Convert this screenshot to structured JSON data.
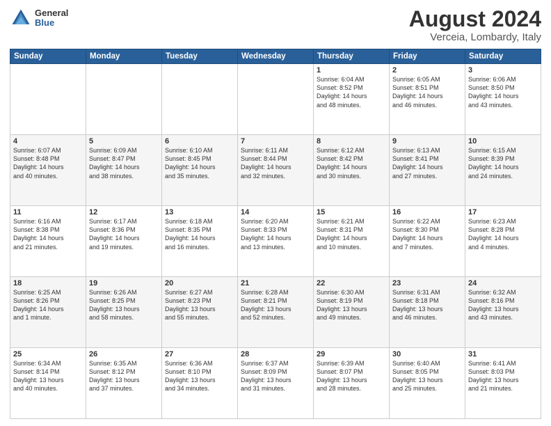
{
  "header": {
    "logo_general": "General",
    "logo_blue": "Blue",
    "title": "August 2024",
    "subtitle": "Verceia, Lombardy, Italy"
  },
  "weekdays": [
    "Sunday",
    "Monday",
    "Tuesday",
    "Wednesday",
    "Thursday",
    "Friday",
    "Saturday"
  ],
  "weeks": [
    [
      {
        "day": "",
        "info": ""
      },
      {
        "day": "",
        "info": ""
      },
      {
        "day": "",
        "info": ""
      },
      {
        "day": "",
        "info": ""
      },
      {
        "day": "1",
        "info": "Sunrise: 6:04 AM\nSunset: 8:52 PM\nDaylight: 14 hours\nand 48 minutes."
      },
      {
        "day": "2",
        "info": "Sunrise: 6:05 AM\nSunset: 8:51 PM\nDaylight: 14 hours\nand 46 minutes."
      },
      {
        "day": "3",
        "info": "Sunrise: 6:06 AM\nSunset: 8:50 PM\nDaylight: 14 hours\nand 43 minutes."
      }
    ],
    [
      {
        "day": "4",
        "info": "Sunrise: 6:07 AM\nSunset: 8:48 PM\nDaylight: 14 hours\nand 40 minutes."
      },
      {
        "day": "5",
        "info": "Sunrise: 6:09 AM\nSunset: 8:47 PM\nDaylight: 14 hours\nand 38 minutes."
      },
      {
        "day": "6",
        "info": "Sunrise: 6:10 AM\nSunset: 8:45 PM\nDaylight: 14 hours\nand 35 minutes."
      },
      {
        "day": "7",
        "info": "Sunrise: 6:11 AM\nSunset: 8:44 PM\nDaylight: 14 hours\nand 32 minutes."
      },
      {
        "day": "8",
        "info": "Sunrise: 6:12 AM\nSunset: 8:42 PM\nDaylight: 14 hours\nand 30 minutes."
      },
      {
        "day": "9",
        "info": "Sunrise: 6:13 AM\nSunset: 8:41 PM\nDaylight: 14 hours\nand 27 minutes."
      },
      {
        "day": "10",
        "info": "Sunrise: 6:15 AM\nSunset: 8:39 PM\nDaylight: 14 hours\nand 24 minutes."
      }
    ],
    [
      {
        "day": "11",
        "info": "Sunrise: 6:16 AM\nSunset: 8:38 PM\nDaylight: 14 hours\nand 21 minutes."
      },
      {
        "day": "12",
        "info": "Sunrise: 6:17 AM\nSunset: 8:36 PM\nDaylight: 14 hours\nand 19 minutes."
      },
      {
        "day": "13",
        "info": "Sunrise: 6:18 AM\nSunset: 8:35 PM\nDaylight: 14 hours\nand 16 minutes."
      },
      {
        "day": "14",
        "info": "Sunrise: 6:20 AM\nSunset: 8:33 PM\nDaylight: 14 hours\nand 13 minutes."
      },
      {
        "day": "15",
        "info": "Sunrise: 6:21 AM\nSunset: 8:31 PM\nDaylight: 14 hours\nand 10 minutes."
      },
      {
        "day": "16",
        "info": "Sunrise: 6:22 AM\nSunset: 8:30 PM\nDaylight: 14 hours\nand 7 minutes."
      },
      {
        "day": "17",
        "info": "Sunrise: 6:23 AM\nSunset: 8:28 PM\nDaylight: 14 hours\nand 4 minutes."
      }
    ],
    [
      {
        "day": "18",
        "info": "Sunrise: 6:25 AM\nSunset: 8:26 PM\nDaylight: 14 hours\nand 1 minute."
      },
      {
        "day": "19",
        "info": "Sunrise: 6:26 AM\nSunset: 8:25 PM\nDaylight: 13 hours\nand 58 minutes."
      },
      {
        "day": "20",
        "info": "Sunrise: 6:27 AM\nSunset: 8:23 PM\nDaylight: 13 hours\nand 55 minutes."
      },
      {
        "day": "21",
        "info": "Sunrise: 6:28 AM\nSunset: 8:21 PM\nDaylight: 13 hours\nand 52 minutes."
      },
      {
        "day": "22",
        "info": "Sunrise: 6:30 AM\nSunset: 8:19 PM\nDaylight: 13 hours\nand 49 minutes."
      },
      {
        "day": "23",
        "info": "Sunrise: 6:31 AM\nSunset: 8:18 PM\nDaylight: 13 hours\nand 46 minutes."
      },
      {
        "day": "24",
        "info": "Sunrise: 6:32 AM\nSunset: 8:16 PM\nDaylight: 13 hours\nand 43 minutes."
      }
    ],
    [
      {
        "day": "25",
        "info": "Sunrise: 6:34 AM\nSunset: 8:14 PM\nDaylight: 13 hours\nand 40 minutes."
      },
      {
        "day": "26",
        "info": "Sunrise: 6:35 AM\nSunset: 8:12 PM\nDaylight: 13 hours\nand 37 minutes."
      },
      {
        "day": "27",
        "info": "Sunrise: 6:36 AM\nSunset: 8:10 PM\nDaylight: 13 hours\nand 34 minutes."
      },
      {
        "day": "28",
        "info": "Sunrise: 6:37 AM\nSunset: 8:09 PM\nDaylight: 13 hours\nand 31 minutes."
      },
      {
        "day": "29",
        "info": "Sunrise: 6:39 AM\nSunset: 8:07 PM\nDaylight: 13 hours\nand 28 minutes."
      },
      {
        "day": "30",
        "info": "Sunrise: 6:40 AM\nSunset: 8:05 PM\nDaylight: 13 hours\nand 25 minutes."
      },
      {
        "day": "31",
        "info": "Sunrise: 6:41 AM\nSunset: 8:03 PM\nDaylight: 13 hours\nand 21 minutes."
      }
    ]
  ]
}
